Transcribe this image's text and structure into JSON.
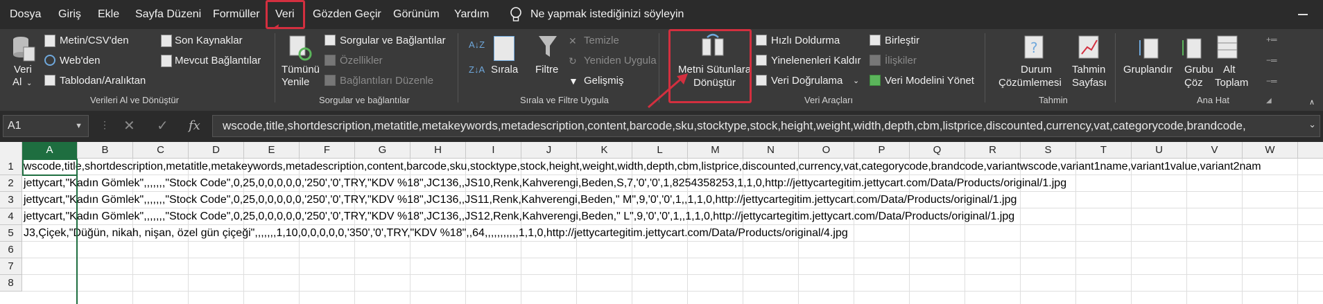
{
  "menu": {
    "tabs": [
      "Dosya",
      "Giriş",
      "Ekle",
      "Sayfa Düzeni",
      "Formüller",
      "Veri",
      "Gözden Geçir",
      "Görünüm",
      "Yardım"
    ],
    "tell_me": "Ne yapmak istediğinizi söyleyin"
  },
  "ribbon": {
    "get_data": {
      "veri_al": "Veri",
      "veri_al2": "Al",
      "metin_csv": "Metin/CSV'den",
      "web": "Web'den",
      "tablo": "Tablodan/Aralıktan",
      "son_kaynaklar": "Son Kaynaklar",
      "mevcut": "Mevcut Bağlantılar",
      "group": "Verileri Al ve Dönüştür"
    },
    "queries": {
      "tumunu": "Tümünü",
      "yenile": "Yenile",
      "sorgular": "Sorgular ve Bağlantılar",
      "ozellikler": "Özellikler",
      "baglantilar": "Bağlantıları Düzenle",
      "group": "Sorgular ve bağlantılar"
    },
    "sort": {
      "sirala": "Sırala",
      "filtre": "Filtre",
      "temizle": "Temizle",
      "yeniden": "Yeniden Uygula",
      "gelismis": "Gelişmiş",
      "group": "Sırala ve Filtre Uygula"
    },
    "tools": {
      "metni1": "Metni Sütunlara",
      "metni2": "Dönüştür",
      "hizli": "Hızlı Doldurma",
      "yinelenen": "Yinelenenleri Kaldır",
      "dogrulama": "Veri Doğrulama",
      "birlestir": "Birleştir",
      "iliskiler": "İlişkiler",
      "model": "Veri Modelini Yönet",
      "group": "Veri Araçları"
    },
    "forecast": {
      "durum1": "Durum",
      "durum2": "Çözümlemesi",
      "tahmin1": "Tahmin",
      "tahmin2": "Sayfası",
      "group": "Tahmin"
    },
    "outline": {
      "grup1": "Gruplandır",
      "coz1": "Grubu",
      "coz2": "Çöz",
      "alt1": "Alt",
      "alt2": "Toplam",
      "group": "Ana Hat"
    }
  },
  "formula_bar": {
    "name_box": "A1",
    "fx": "fx",
    "content": "wscode,title,shortdescription,metatitle,metakeywords,metadescription,content,barcode,sku,stocktype,stock,height,weight,width,depth,cbm,listprice,discounted,currency,vat,categorycode,brandcode,"
  },
  "grid": {
    "columns": [
      "A",
      "B",
      "C",
      "D",
      "E",
      "F",
      "G",
      "H",
      "I",
      "J",
      "K",
      "L",
      "M",
      "N",
      "O",
      "P",
      "Q",
      "R",
      "S",
      "T",
      "U",
      "V",
      "W"
    ],
    "rows": [
      "1",
      "2",
      "3",
      "4",
      "5",
      "6",
      "7",
      "8"
    ],
    "cells": [
      "wscode,title,shortdescription,metatitle,metakeywords,metadescription,content,barcode,sku,stocktype,stock,height,weight,width,depth,cbm,listprice,discounted,currency,vat,categorycode,brandcode,variantwscode,variant1name,variant1value,variant2nam",
      "jettycart,\"Kadın Gömlek\",,,,,,,\"Stock Code\",0,25,0,0,0,0,0,'250','0',TRY,\"KDV %18\",JC136,,JS10,Renk,Kahverengi,Beden,S,7,'0','0',1,8254358253,1,1,0,http://jettycartegitim.jettycart.com/Data/Products/original/1.jpg",
      "jettycart,\"Kadın Gömlek\",,,,,,,\"Stock Code\",0,25,0,0,0,0,0,'250','0',TRY,\"KDV %18\",JC136,,JS11,Renk,Kahverengi,Beden,\" M\",9,'0','0',1,,1,1,0,http://jettycartegitim.jettycart.com/Data/Products/original/1.jpg",
      "jettycart,\"Kadın Gömlek\",,,,,,,\"Stock Code\",0,25,0,0,0,0,0,'250','0',TRY,\"KDV %18\",JC136,,JS12,Renk,Kahverengi,Beden,\" L\",9,'0','0',1,,1,1,0,http://jettycartegitim.jettycart.com/Data/Products/original/1.jpg",
      "J3,Çiçek,\"Düğün, nikah, nişan, özel gün çiçeği\",,,,,,,1,10,0,0,0,0,0,'350','0',TRY,\"KDV %18\",,64,,,,,,,,,,,1,1,0,http://jettycartegitim.jettycart.com/Data/Products/original/4.jpg"
    ]
  },
  "colors": {
    "accent": "#1e6e40",
    "highlight": "#d32f3f"
  }
}
